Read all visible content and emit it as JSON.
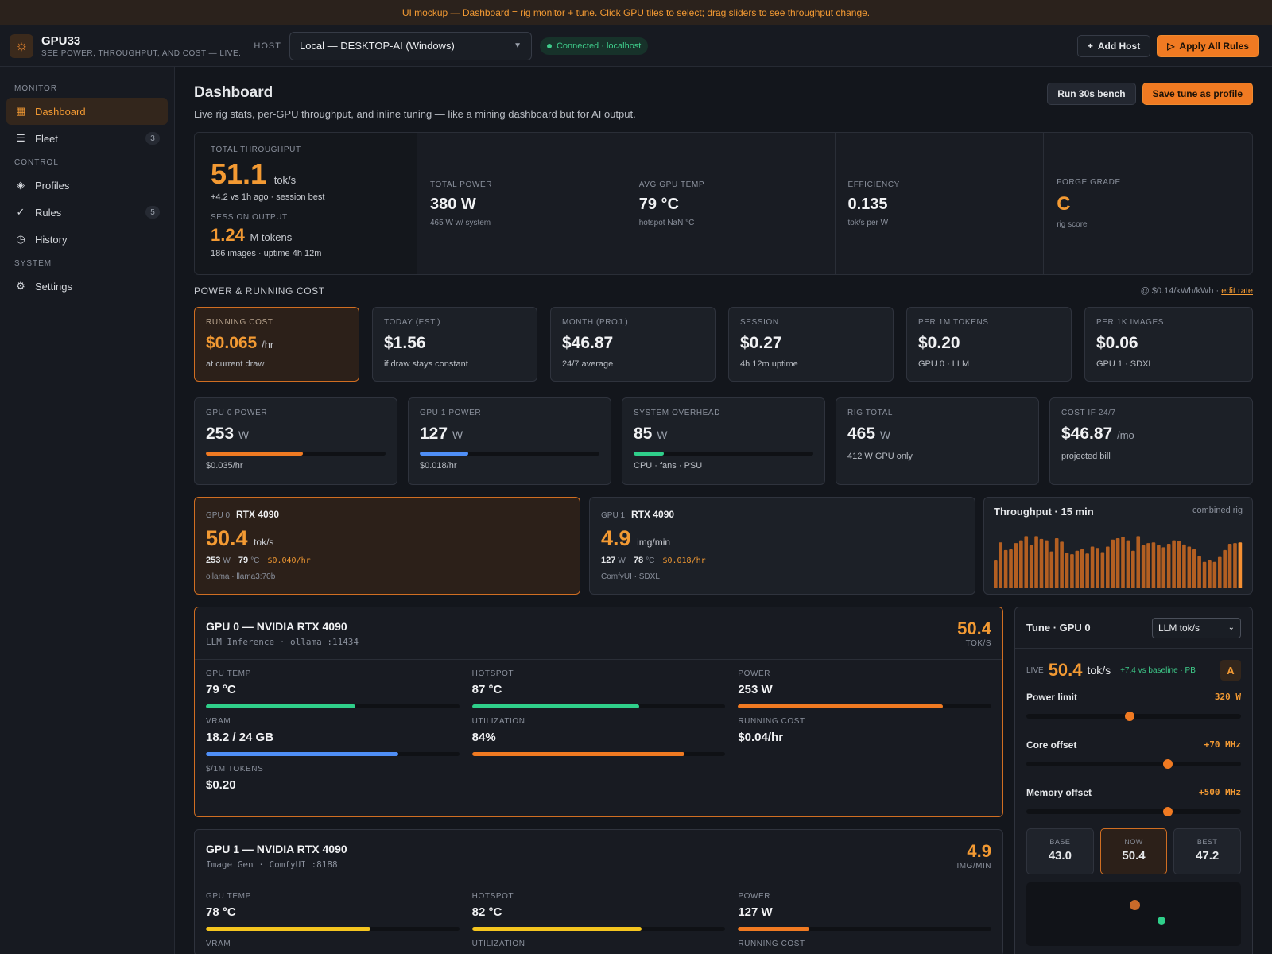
{
  "banner": "UI mockup — Dashboard = rig monitor + tune. Click GPU tiles to select; drag sliders to see throughput change.",
  "app": {
    "name": "GPU33",
    "tagline": "SEE POWER, THROUGHPUT, AND COST — LIVE.",
    "logo_icon": "sun-icon"
  },
  "host": {
    "label": "HOST",
    "selected": "Local — DESKTOP-AI (Windows)",
    "status": "Connected · localhost"
  },
  "topbar": {
    "add_host": "Add Host",
    "apply_rules": "Apply All Rules"
  },
  "sidebar": {
    "sections": [
      "MONITOR",
      "CONTROL",
      "SYSTEM"
    ],
    "items": [
      {
        "label": "Dashboard",
        "icon": "grid-icon",
        "active": true
      },
      {
        "label": "Fleet",
        "icon": "server-icon",
        "count": "3"
      },
      {
        "label": "Profiles",
        "icon": "layers-icon"
      },
      {
        "label": "Rules",
        "icon": "check-circle-icon",
        "count": "5"
      },
      {
        "label": "History",
        "icon": "clock-icon"
      },
      {
        "label": "Settings",
        "icon": "gear-icon"
      }
    ]
  },
  "page": {
    "title": "Dashboard",
    "subtitle": "Live rig stats, per-GPU throughput, and inline tuning — like a mining dashboard but for AI output.",
    "bench": "Run 30s bench",
    "save": "Save tune as profile"
  },
  "kpi": {
    "throughput": {
      "label": "TOTAL THROUGHPUT",
      "value": "51.1",
      "unit": "tok/s",
      "note": "+4.2 vs 1h ago · session best"
    },
    "session": {
      "label": "SESSION OUTPUT",
      "value": "1.24",
      "unit": "M tokens",
      "note": "186 images · uptime 4h 12m"
    },
    "cells": [
      {
        "label": "TOTAL POWER",
        "value": "380 W",
        "note": "465 W w/ system"
      },
      {
        "label": "AVG GPU TEMP",
        "value": "79 °C",
        "note": "hotspot NaN °C"
      },
      {
        "label": "EFFICIENCY",
        "value": "0.135",
        "note": "tok/s per W"
      },
      {
        "label": "FORGE GRADE",
        "value": "C",
        "note": "rig score"
      }
    ]
  },
  "cost_section": {
    "title": "POWER & RUNNING COST",
    "rate": "@ $0.14/kWh/kWh ·",
    "edit": "edit rate"
  },
  "costs": [
    {
      "label": "RUNNING COST",
      "value": "$0.065",
      "unit": "/hr",
      "note": "at current draw"
    },
    {
      "label": "TODAY (EST.)",
      "value": "$1.56",
      "unit": "",
      "note": "if draw stays constant"
    },
    {
      "label": "MONTH (PROJ.)",
      "value": "$46.87",
      "unit": "",
      "note": "24/7 average"
    },
    {
      "label": "SESSION",
      "value": "$0.27",
      "unit": "",
      "note": "4h 12m uptime"
    },
    {
      "label": "PER 1M TOKENS",
      "value": "$0.20",
      "unit": "",
      "note": "GPU 0 · LLM"
    },
    {
      "label": "PER 1K IMAGES",
      "value": "$0.06",
      "unit": "",
      "note": "GPU 1 · SDXL"
    }
  ],
  "power": [
    {
      "label": "GPU 0 POWER",
      "value": "253",
      "unit": "W",
      "note": "$0.035/hr",
      "fill": 0.54,
      "color": "#f07a22"
    },
    {
      "label": "GPU 1 POWER",
      "value": "127",
      "unit": "W",
      "note": "$0.018/hr",
      "fill": 0.27,
      "color": "#4f8ff7"
    },
    {
      "label": "SYSTEM OVERHEAD",
      "value": "85",
      "unit": "W",
      "note": "CPU · fans · PSU",
      "fill": 0.17,
      "color": "#2fcf8a"
    },
    {
      "label": "RIG TOTAL",
      "value": "465",
      "unit": "W",
      "note": "412 W GPU only"
    },
    {
      "label": "COST IF 24/7",
      "value": "$46.87",
      "unit": "/mo",
      "note": "projected bill"
    }
  ],
  "tiles": [
    {
      "idx": "GPU 0",
      "model": "RTX 4090",
      "rate": "50.4",
      "unit": "tok/s",
      "w": "253",
      "wu": "W",
      "t": "79",
      "tu": "°C",
      "cost": "$0.040/hr",
      "foot": "ollama · llama3:70b"
    },
    {
      "idx": "GPU 1",
      "model": "RTX 4090",
      "rate": "4.9",
      "unit": "img/min",
      "w": "127",
      "wu": "W",
      "t": "78",
      "tu": "°C",
      "cost": "$0.018/hr",
      "foot": "ComfyUI · SDXL"
    }
  ],
  "throughput_chart": {
    "title": "Throughput · 15 min",
    "note": "combined rig",
    "chart_data": {
      "type": "bar",
      "values": [
        40,
        66,
        55,
        56,
        65,
        69,
        75,
        62,
        75,
        71,
        69,
        53,
        72,
        67,
        51,
        49,
        54,
        56,
        50,
        60,
        58,
        52,
        60,
        70,
        72,
        74,
        69,
        54,
        75,
        62,
        65,
        66,
        62,
        59,
        64,
        69,
        68,
        63,
        60,
        56,
        46,
        38,
        40,
        38,
        45,
        55,
        64,
        65,
        66
      ]
    }
  },
  "gpu_cards": [
    {
      "title": "GPU 0 — NVIDIA RTX 4090",
      "sub": "LLM Inference · ollama :11434",
      "rate": "50.4",
      "rate_unit": "TOK/S",
      "metrics": [
        {
          "label": "GPU TEMP",
          "value": "79 °C",
          "fill": 0.59,
          "color": "#2fcf8a"
        },
        {
          "label": "HOTSPOT",
          "value": "87 °C",
          "fill": 0.66,
          "color": "#2fcf8a"
        },
        {
          "label": "POWER",
          "value": "253 W",
          "fill": 0.81,
          "color": "#f07a22"
        },
        {
          "label": "VRAM",
          "value": "18.2 / 24 GB",
          "fill": 0.76,
          "color": "#4f8ff7"
        },
        {
          "label": "UTILIZATION",
          "value": "84%",
          "fill": 0.84,
          "color": "#f07a22"
        },
        {
          "label": "RUNNING COST",
          "value": "$0.04/hr"
        },
        {
          "label": "$/1M TOKENS",
          "value": "$0.20"
        }
      ]
    },
    {
      "title": "GPU 1 — NVIDIA RTX 4090",
      "sub": "Image Gen · ComfyUI :8188",
      "rate": "4.9",
      "rate_unit": "IMG/MIN",
      "metrics": [
        {
          "label": "GPU TEMP",
          "value": "78 °C",
          "fill": 0.65,
          "color": "#f5c51f"
        },
        {
          "label": "HOTSPOT",
          "value": "82 °C",
          "fill": 0.67,
          "color": "#f5c51f"
        },
        {
          "label": "POWER",
          "value": "127 W",
          "fill": 0.28,
          "color": "#f07a22"
        },
        {
          "label": "VRAM",
          "value": ""
        },
        {
          "label": "UTILIZATION",
          "value": ""
        },
        {
          "label": "RUNNING COST",
          "value": ""
        }
      ]
    }
  ],
  "tune": {
    "title": "Tune · GPU 0",
    "mode": "LLM tok/s",
    "live_label": "LIVE",
    "live": "50.4",
    "live_unit": "tok/s",
    "delta": "+7.4 vs baseline · PB",
    "grade": "A",
    "sliders": [
      {
        "label": "Power limit",
        "value": "320 W",
        "level": 0.48
      },
      {
        "label": "Core offset",
        "value": "+70 MHz",
        "level": 0.66
      },
      {
        "label": "Memory offset",
        "value": "+500 MHz",
        "level": 0.66
      }
    ],
    "stats": [
      {
        "label": "BASE",
        "value": "43.0"
      },
      {
        "label": "NOW",
        "value": "50.4"
      },
      {
        "label": "BEST",
        "value": "47.2"
      }
    ]
  }
}
